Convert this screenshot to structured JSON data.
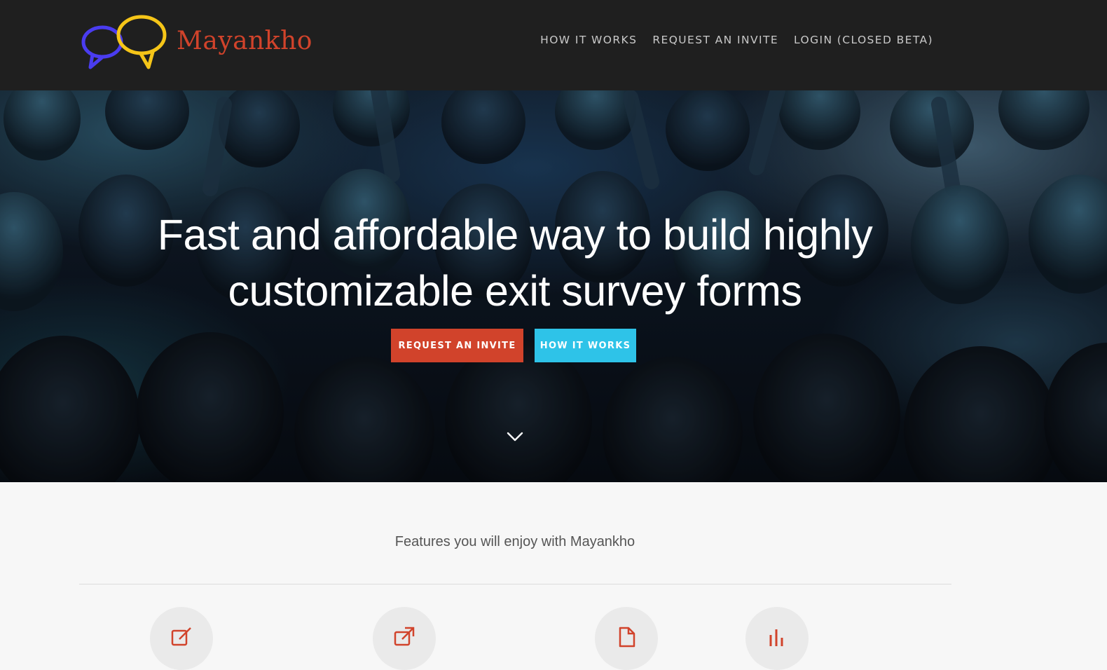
{
  "header": {
    "brand_name": "Mayankho",
    "logo_icon": "speech-bubbles-logo-icon",
    "nav": [
      {
        "label": "HOW IT WORKS"
      },
      {
        "label": "REQUEST AN INVITE"
      },
      {
        "label": "LOGIN (CLOSED BETA)"
      }
    ]
  },
  "hero": {
    "headline_line1": "Fast and affordable way to build highly",
    "headline_line2": "customizable exit survey forms",
    "primary_button": "REQUEST AN INVITE",
    "secondary_button": "HOW IT WORKS",
    "scroll_icon": "chevron-down-icon",
    "background_image": "concert-crowd-image"
  },
  "features": {
    "title": "Features you will enjoy with Mayankho",
    "icons": [
      "edit-icon",
      "share-icon",
      "document-icon",
      "bar-chart-icon"
    ]
  },
  "colors": {
    "header_bg": "#1f1f1f",
    "brand_red": "#d1432b",
    "accent_cyan": "#2ec3e8",
    "logo_blue": "#4a3cf0",
    "logo_yellow": "#f5c518",
    "page_bg": "#f7f7f7"
  }
}
